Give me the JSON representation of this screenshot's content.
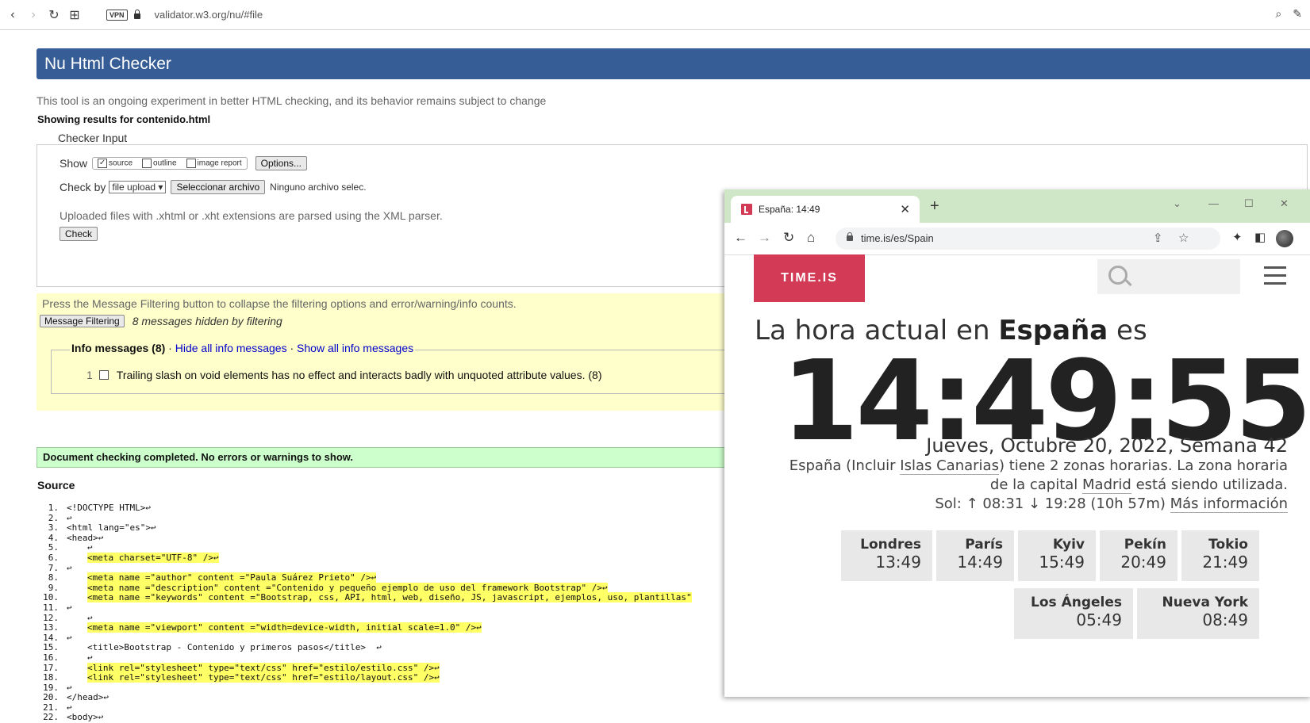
{
  "browser": {
    "vpn_label": "VPN",
    "url": "validator.w3.org/nu/#file"
  },
  "nu": {
    "title": "Nu Html Checker",
    "subtitle": "This tool is an ongoing experiment in better HTML checking, and its behavior remains subject to change",
    "showing": "Showing results for contenido.html",
    "checker_legend": "Checker Input",
    "show_label": "Show",
    "options": [
      {
        "label": "source",
        "checked": true
      },
      {
        "label": "outline",
        "checked": false
      },
      {
        "label": "image report",
        "checked": false
      }
    ],
    "options_button": "Options...",
    "check_by_label": "Check by",
    "check_by_value": "file upload",
    "file_button": "Seleccionar archivo",
    "file_status": "Ninguno archivo selec.",
    "xml_note": "Uploaded files with .xhtml or .xht extensions are parsed using the XML parser.",
    "check_button": "Check",
    "filter_text": "Press the Message Filtering button to collapse the filtering options and error/warning/info counts.",
    "filter_button": "Message Filtering",
    "hidden_msg": "8 messages hidden by filtering",
    "info_title": "Info messages (8)",
    "sep": "·",
    "hide_info": "Hide all info messages",
    "show_info": "Show all info messages",
    "info_items": [
      {
        "num": "1",
        "text": "Trailing slash on void elements has no effect and interacts badly with unquoted attribute values. (8)"
      }
    ],
    "result": "Document checking completed. No errors or warnings to show.",
    "source_heading": "Source",
    "source_lines": [
      {
        "n": "1.",
        "text": "<!DOCTYPE HTML>↩",
        "hl": false,
        "indent": 0
      },
      {
        "n": "2.",
        "text": "↩",
        "hl": false,
        "indent": 0
      },
      {
        "n": "3.",
        "text": "<html lang=\"es\">↩",
        "hl": false,
        "indent": 0
      },
      {
        "n": "4.",
        "text": "<head>↩",
        "hl": false,
        "indent": 0
      },
      {
        "n": "5.",
        "text": "↩",
        "hl": false,
        "indent": 1
      },
      {
        "n": "6.",
        "text": "<meta charset=\"UTF-8\" />↩",
        "hl": true,
        "indent": 1
      },
      {
        "n": "7.",
        "text": "↩",
        "hl": false,
        "indent": 0
      },
      {
        "n": "8.",
        "text": "<meta name =\"author\" content =\"Paula Suárez Prieto\" />↩",
        "hl": true,
        "indent": 1
      },
      {
        "n": "9.",
        "text": "<meta name =\"description\" content =\"Contenido y pequeño ejemplo de uso del framework Bootstrap\" />↩",
        "hl": true,
        "indent": 1
      },
      {
        "n": "10.",
        "text": "<meta name =\"keywords\" content =\"Bootstrap, css, API, html, web, diseño, JS, javascript, ejemplos, uso, plantillas\"",
        "hl": true,
        "indent": 1
      },
      {
        "n": "11.",
        "text": "↩",
        "hl": false,
        "indent": 0
      },
      {
        "n": "12.",
        "text": "↩",
        "hl": false,
        "indent": 1
      },
      {
        "n": "13.",
        "text": "<meta name =\"viewport\" content =\"width=device-width, initial scale=1.0\" />↩",
        "hl": true,
        "indent": 1
      },
      {
        "n": "14.",
        "text": "↩",
        "hl": false,
        "indent": 0
      },
      {
        "n": "15.",
        "text": "<title>Bootstrap - Contenido y primeros pasos</title>  ↩",
        "hl": false,
        "indent": 1
      },
      {
        "n": "16.",
        "text": "↩",
        "hl": false,
        "indent": 1
      },
      {
        "n": "17.",
        "text": "<link rel=\"stylesheet\" type=\"text/css\" href=\"estilo/estilo.css\" />↩",
        "hl": true,
        "indent": 1
      },
      {
        "n": "18.",
        "text": "<link rel=\"stylesheet\" type=\"text/css\" href=\"estilo/layout.css\" />↩",
        "hl": true,
        "indent": 1
      },
      {
        "n": "19.",
        "text": "↩",
        "hl": false,
        "indent": 0
      },
      {
        "n": "20.",
        "text": "</head>↩",
        "hl": false,
        "indent": 0
      },
      {
        "n": "21.",
        "text": "↩",
        "hl": false,
        "indent": 0
      },
      {
        "n": "22.",
        "text": "<body>↩",
        "hl": false,
        "indent": 0
      }
    ]
  },
  "timeis": {
    "tab_title": "España: 14:49",
    "url": "time.is/es/Spain",
    "logo": "TIME.IS",
    "heading_pre": "La hora actual en ",
    "heading_country": "España",
    "heading_post": " es",
    "clock": "14:49:55",
    "date": "Jueves, Octubre 20, 2022, Semana 42",
    "zones_pre": "España (Incluir ",
    "zones_link1": "Islas Canarias",
    "zones_mid": ") tiene 2 zonas horarias. La zona horaria de la capital ",
    "zones_link2": "Madrid",
    "zones_post": " está siendo utilizada.",
    "sun_text": "Sol: ↑ 08:31 ↓ 19:28 (10h 57m) ",
    "sun_link": "Más información",
    "cities": [
      {
        "name": "Londres",
        "time": "13:49"
      },
      {
        "name": "París",
        "time": "14:49"
      },
      {
        "name": "Kyiv",
        "time": "15:49"
      },
      {
        "name": "Pekín",
        "time": "20:49"
      },
      {
        "name": "Tokio",
        "time": "21:49"
      },
      {
        "name": "Los Ángeles",
        "time": "05:49"
      },
      {
        "name": "Nueva York",
        "time": "08:49"
      }
    ]
  },
  "colors": {
    "nu_header": "#365d95",
    "timeis_brand": "#d23a55",
    "tabstrip": "#cfe7c6",
    "success_bg": "#ccffcc",
    "filter_bg": "#ffffcc"
  }
}
